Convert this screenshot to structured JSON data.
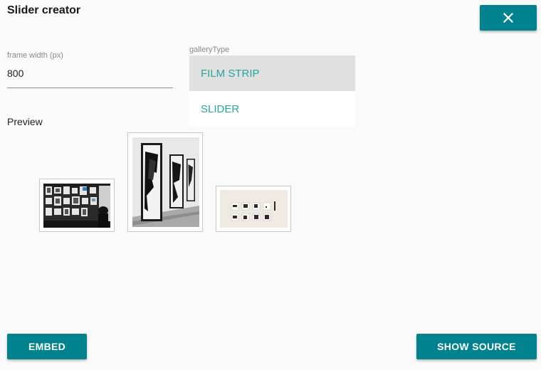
{
  "header": {
    "title": "Slider creator",
    "close_icon": "close-icon"
  },
  "form": {
    "frame_width_label": "frame width (px)",
    "frame_width_value": "800",
    "gallery_type_label": "galleryType",
    "gallery_type_options": [
      "FILM STRIP",
      "SLIDER"
    ],
    "gallery_type_selected": "FILM STRIP"
  },
  "preview": {
    "label": "Preview",
    "images": [
      {
        "subject": "gallery-wall-framed-photos-with-visitor"
      },
      {
        "subject": "gallery-hallway-large-black-white-prints"
      },
      {
        "subject": "white-wall-small-framed-prints"
      }
    ]
  },
  "actions": {
    "embed_label": "EMBED",
    "show_source_label": "SHOW SOURCE"
  },
  "colors": {
    "accent": "#00838f",
    "option_text": "#26a69a",
    "selected_option_bg": "#e0e0e0"
  }
}
